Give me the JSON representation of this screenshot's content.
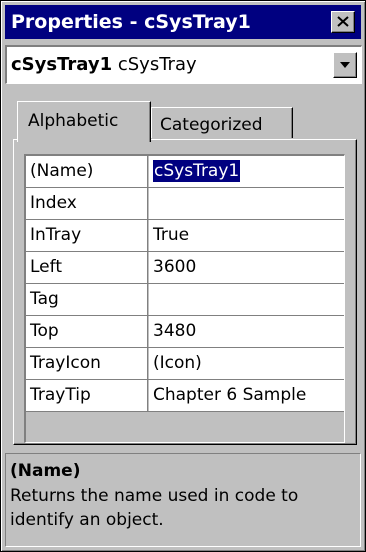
{
  "window": {
    "title": "Properties - cSysTray1"
  },
  "object_selector": {
    "object_name": "cSysTray1",
    "object_type": "cSysTray"
  },
  "tabs": [
    {
      "label": "Alphabetic",
      "active": true
    },
    {
      "label": "Categorized",
      "active": false
    }
  ],
  "properties": [
    {
      "name": "(Name)",
      "value": "cSysTray1",
      "selected": true
    },
    {
      "name": "Index",
      "value": ""
    },
    {
      "name": "InTray",
      "value": "True"
    },
    {
      "name": "Left",
      "value": "3600"
    },
    {
      "name": "Tag",
      "value": ""
    },
    {
      "name": "Top",
      "value": "3480"
    },
    {
      "name": "TrayIcon",
      "value": "(Icon)"
    },
    {
      "name": "TrayTip",
      "value": "Chapter 6 Sample"
    }
  ],
  "description": {
    "title": "(Name)",
    "text": "Returns the name used in code to identify an object."
  },
  "icons": {
    "close": "close-icon",
    "dropdown": "chevron-down-icon"
  },
  "colors": {
    "titlebar": "#000080",
    "face": "#c0c0c0",
    "selection": "#000080"
  }
}
